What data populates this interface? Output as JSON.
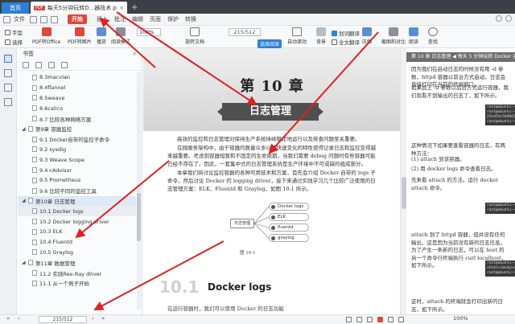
{
  "titlebar": {
    "home_tab": "首页",
    "doc_tab_badge": "PDF",
    "doc_tab_title": "每天5分钟玩转D...器技术.pdf",
    "close_glyph": "×",
    "new_tab_glyph": "+"
  },
  "menubar": {
    "file": "文件",
    "start": "开始",
    "items": [
      "插入",
      "批注",
      "编辑",
      "页面",
      "保护",
      "转换"
    ]
  },
  "toolbar": {
    "hand": "手型",
    "select": "选择",
    "pdf_to_office": "PDF转Office",
    "pdf_to_image": "PDF转图片",
    "play": "播放",
    "read_mode": "阅读模式",
    "zoom_value": "100%",
    "rotate": "旋转文档",
    "page_value": "215/512",
    "read_btn": "选择阅读",
    "auto_scroll": "自动滚动",
    "background": "背景",
    "translate_word": "划词翻译",
    "translate_full": "全文翻译",
    "compress": "压缩",
    "screenshot_compare": "截图和对比",
    "read_aloud": "朗读",
    "find": "查找"
  },
  "panel": {
    "title": "书签",
    "close_glyph": "×",
    "items": [
      {
        "level": 2,
        "label": "8.3macvlan"
      },
      {
        "level": 2,
        "label": "8.4flannel"
      },
      {
        "level": 2,
        "label": "8.5weave"
      },
      {
        "level": 2,
        "label": "8.6calico"
      },
      {
        "level": 2,
        "label": "8.7 比较各种网络方案"
      },
      {
        "level": 1,
        "label": "第9章 容器监控",
        "caret": "◢"
      },
      {
        "level": 2,
        "label": "9.1 Docker自带的监控子命令"
      },
      {
        "level": 2,
        "label": "9.2 sysdig"
      },
      {
        "level": 2,
        "label": "9.3 Weave Scope"
      },
      {
        "level": 2,
        "label": "9.4 cAdvisor"
      },
      {
        "level": 2,
        "label": "9.5 Prometheus"
      },
      {
        "level": 2,
        "label": "9.6 比较不同的监控工具"
      },
      {
        "level": 1,
        "label": "第10章 日志管理",
        "caret": "◢",
        "selected": true
      },
      {
        "level": 2,
        "label": "10.1 Docker logs",
        "highlight": true
      },
      {
        "level": 2,
        "label": "10.2 Docker logging driver"
      },
      {
        "level": 2,
        "label": "10.3 ELK"
      },
      {
        "level": 2,
        "label": "10.4 Fluentd"
      },
      {
        "level": 2,
        "label": "10.5 Graylog"
      },
      {
        "level": 1,
        "label": "第11章 数据管理",
        "caret": "◢"
      },
      {
        "level": 2,
        "label": "11.2 实践Rex-Ray driver"
      },
      {
        "level": 2,
        "label": "11.1 从一个例子开始"
      }
    ]
  },
  "page1": {
    "chapter": "第 10 章",
    "chapter_sub": "日志管理",
    "para1": "高效的监控和日志管理对保持生产系统持续稳定地运行以及排查问题至关重要。",
    "para2": "在微服务架构中，由于容器的数量众多以及快速变化的特性使得记录日志和监控变得越来越重要。考虑到容器短暂和不固定的生命周期，当我们需要 debug 问题时有些容器可能已经不存在了。因此，一套集中式的日志管理系统是生产环境中不可或缺的组成部分。",
    "para3": "本章我们将讨论监控容器的各种可用技术和方案，首先会介绍 Docker 自带的 logs 子命令，然后讨论 Docker 的 logging driver，接下来通过实践学习几个比较广泛使用的日志管理方案：ELK、Fluentd 和 Graylog，如图 10-1 所示。",
    "figure_source": "日志管理",
    "figure_items": [
      "Docker logs",
      "ELK",
      "fluentd",
      "graylog"
    ],
    "figure_caption": "图 10-1",
    "section_num": "10.1",
    "section_title": "Docker logs",
    "footer": "在运行容器时，我们可以使用 Docker 的日志功能"
  },
  "page2": {
    "header": "第 10 章 日志管理 ◀ 每天 5 分钟玩转 Docker 容器技术",
    "text1": "因为我们在启动日志的时候没有用 -d 参数，httpd 容器以前台方式启动，日志会直接打印在当前的终端窗口。",
    "text2": "如果加上 -d 参数以后台方式运行容器，我们就看不到输出的日志了，如下所示。",
    "text3": "这种情况下如果要查看容器的日志，有两种方法：",
    "text4": "(1) attach 到该容器。",
    "text5": "(2) 用 docker logs 命令查看日志。",
    "text6": "先来看 attach 的方法。运行 docker attach 命令。",
    "text7": "attach 到了 httpd 容器，但并没有任何输出，这是因为当前没有新的日志信息。为了产生一条新的日志，可以在 host 的另一个命令行终端执行 curl localhost，如下所示。",
    "text8": "这时，attach 的终端就会打印出新的日志，如下所示。",
    "code1": [
      "root@ubuntu:~#",
      "root@ubuntu:~#",
      "25ed55e7b9842058",
      "root@ubuntu:~#"
    ],
    "code2": [
      "root@ubuntu:~#",
      "root@ubuntu:~#"
    ],
    "code3": [
      "root@ubuntu:~#",
      "<html><body><h1>It",
      "root@ubuntu:~#"
    ]
  },
  "statusbar": {
    "page": "215/512",
    "prev_glyph": "‹",
    "next_glyph": "›",
    "first_glyph": "«",
    "last_glyph": "»",
    "zoom": "100%"
  },
  "colors": {
    "accent_red": "#e0453b",
    "accent_blue": "#2f7fd3",
    "arrow": "#e02020"
  }
}
